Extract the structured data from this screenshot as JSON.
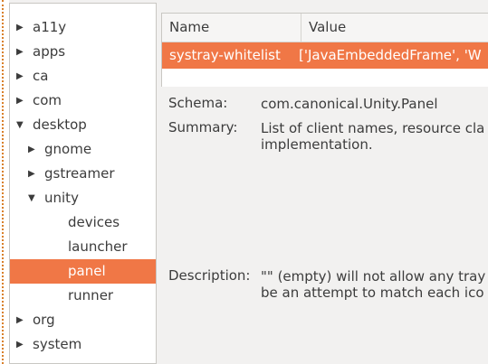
{
  "tree": {
    "items": [
      {
        "label": "a11y",
        "expanded": false
      },
      {
        "label": "apps",
        "expanded": false
      },
      {
        "label": "ca",
        "expanded": false
      },
      {
        "label": "com",
        "expanded": false
      },
      {
        "label": "desktop",
        "expanded": true
      },
      {
        "label": "gnome",
        "expanded": false
      },
      {
        "label": "gstreamer",
        "expanded": false
      },
      {
        "label": "unity",
        "expanded": true
      },
      {
        "label": "devices"
      },
      {
        "label": "launcher"
      },
      {
        "label": "panel",
        "selected": true
      },
      {
        "label": "runner"
      },
      {
        "label": "org",
        "expanded": false
      },
      {
        "label": "system",
        "expanded": false
      }
    ]
  },
  "keys": {
    "headers": {
      "name": "Name",
      "value": "Value"
    },
    "rows": [
      {
        "name": "systray-whitelist",
        "value": "['JavaEmbeddedFrame', 'W"
      }
    ]
  },
  "details": {
    "schema_label": "Schema:",
    "schema_value": "com.canonical.Unity.Panel",
    "summary_label": "Summary:",
    "summary_line1": "List of client names, resource cla",
    "summary_line2": "implementation.",
    "description_label": "Description:",
    "description_line1": "\"\" (empty) will not allow any tray",
    "description_line2": "be an attempt to match each ico"
  },
  "colors": {
    "selection": "#f07746",
    "accent_border": "#d9802a"
  },
  "icons": {
    "collapsed": "triangle-right-icon",
    "expanded": "triangle-down-icon"
  }
}
